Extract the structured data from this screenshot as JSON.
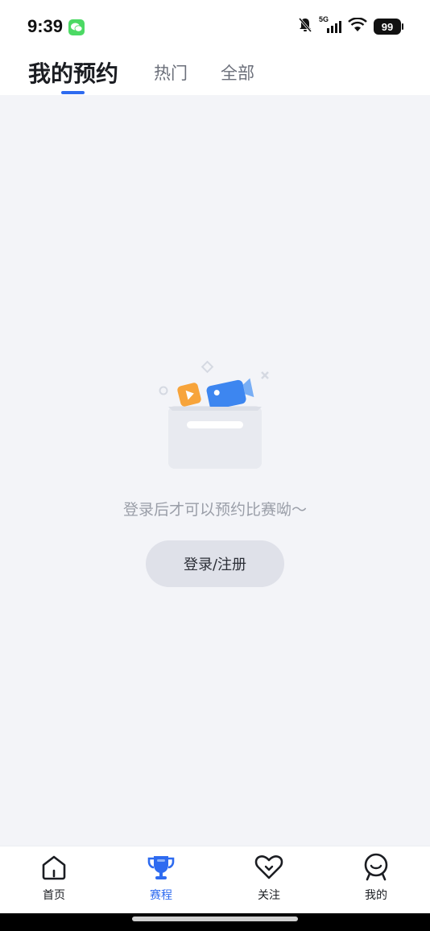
{
  "status_bar": {
    "time": "9:39",
    "network": "5G",
    "battery": "99",
    "icons": [
      "wechat-icon",
      "mute-bell-icon",
      "signal-icon",
      "wifi-icon",
      "battery-icon"
    ]
  },
  "tabs": [
    {
      "label": "我的预约",
      "active": true
    },
    {
      "label": "热门",
      "active": false
    },
    {
      "label": "全部",
      "active": false
    }
  ],
  "empty_state": {
    "message": "登录后才可以预约比赛呦～",
    "login_button": "登录/注册"
  },
  "bottom_nav": [
    {
      "label": "首页",
      "icon": "home-icon",
      "active": false
    },
    {
      "label": "赛程",
      "icon": "trophy-icon",
      "active": true
    },
    {
      "label": "关注",
      "icon": "heart-icon",
      "active": false
    },
    {
      "label": "我的",
      "icon": "profile-icon",
      "active": false
    }
  ],
  "colors": {
    "accent": "#2e6bf0",
    "background": "#f3f4f8",
    "button_bg": "#dfe1e9",
    "muted_text": "#9a9ea8"
  }
}
